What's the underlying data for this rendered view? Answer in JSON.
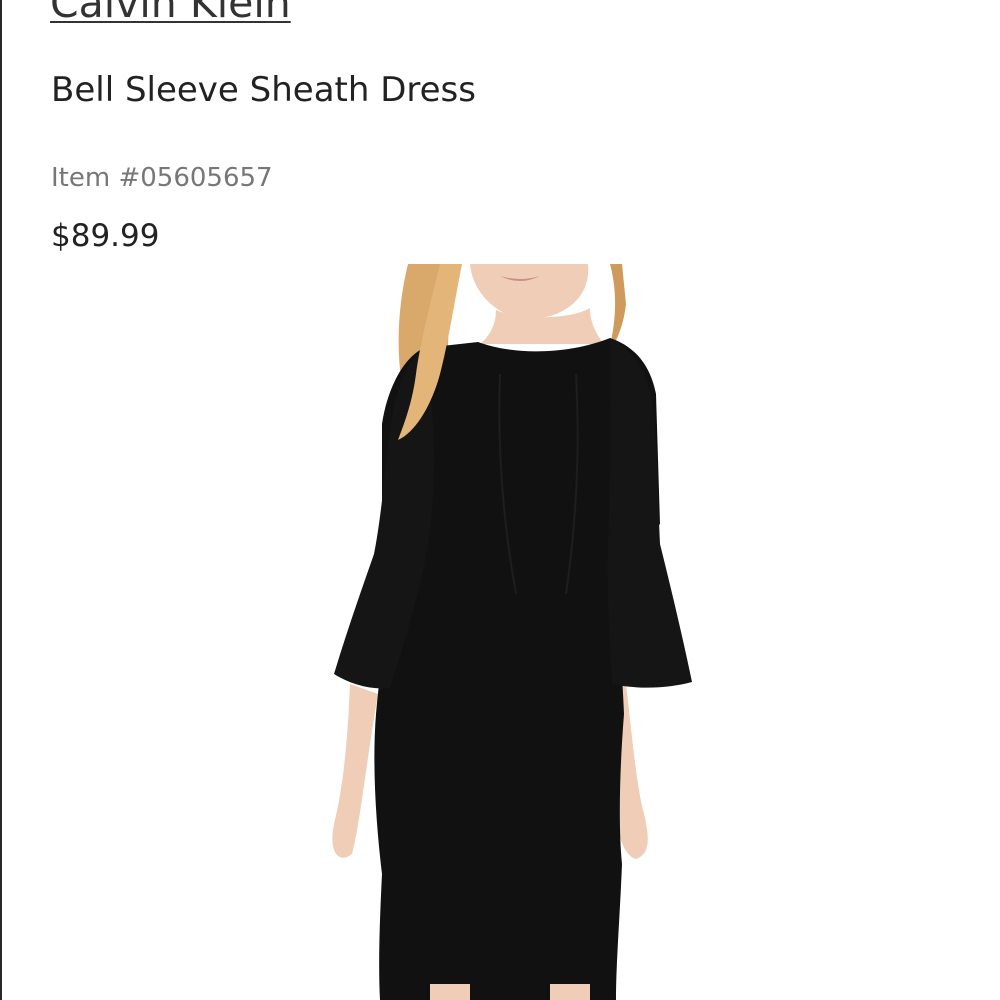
{
  "product": {
    "brand": "Calvin Klein",
    "name": "Bell Sleeve Sheath Dress",
    "item_number": "Item #05605657",
    "price": "$89.99"
  },
  "image": {
    "subject": "model-wearing-black-bell-sleeve-dress",
    "dress_color": "#111111",
    "hair_color": "#d9a86b",
    "skin_color": "#efcdb6"
  }
}
